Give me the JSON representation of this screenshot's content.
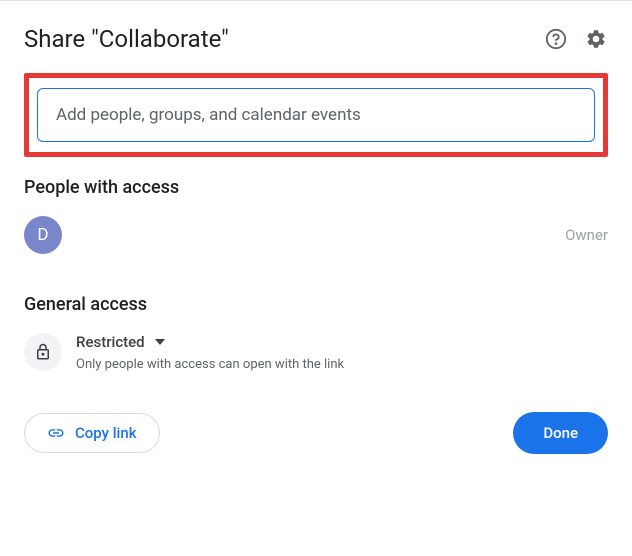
{
  "title": "Share \"Collaborate\"",
  "input": {
    "placeholder": "Add people, groups, and calendar events",
    "value": ""
  },
  "people_section": {
    "heading": "People with access",
    "items": [
      {
        "initial": "D",
        "role": "Owner"
      }
    ]
  },
  "general_section": {
    "heading": "General access",
    "selected": "Restricted",
    "description": "Only people with access can open with the link"
  },
  "footer": {
    "copy_link": "Copy link",
    "done": "Done"
  }
}
